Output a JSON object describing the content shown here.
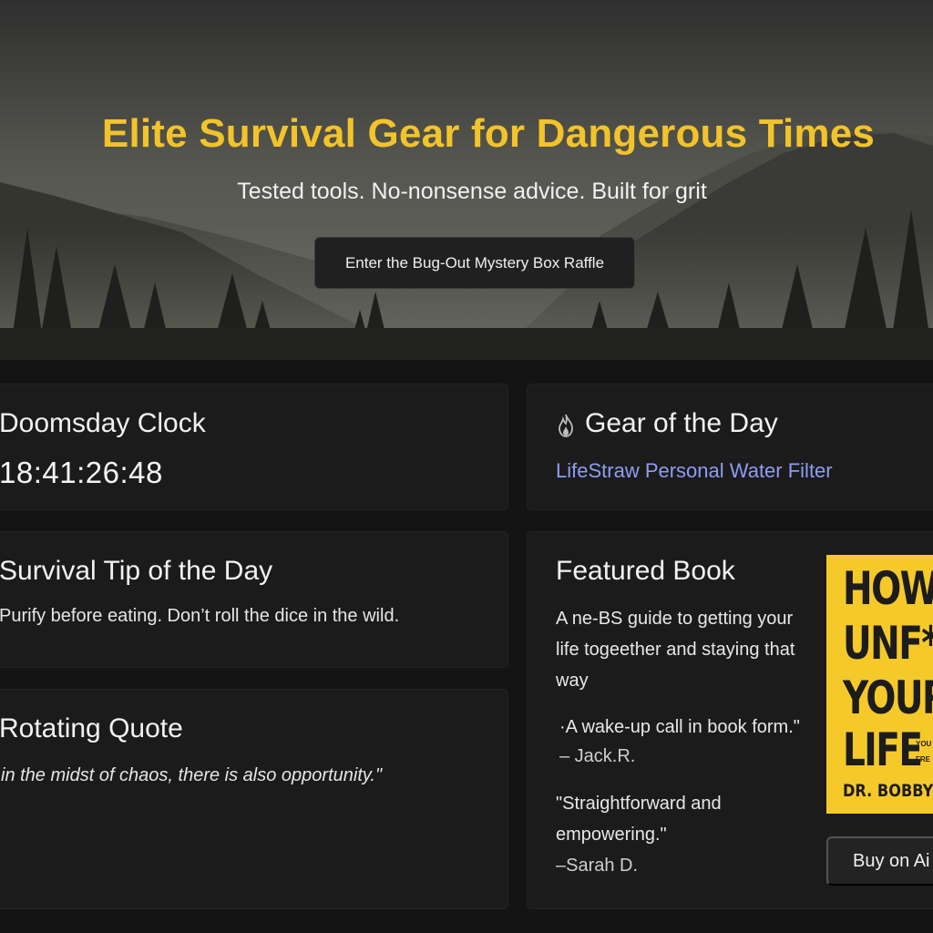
{
  "hero": {
    "title": "Elite Survival Gear for Dangerous Times",
    "subtitle": "Tested tools. No-nonsense advice. Built for grit",
    "cta_label": "Enter the Bug-Out Mystery Box Raffle"
  },
  "doomsday": {
    "title": "Doomsday Clock",
    "value": "18:41:26:48"
  },
  "gear": {
    "icon": "flame-icon",
    "title": "Gear of the Day",
    "item": "LifeStraw Personal Water Filter"
  },
  "tip": {
    "title": "Survival Tip of the Day",
    "text": "Purify before eating. Don’t roll the dice in the wild."
  },
  "quote": {
    "title": "Rotating Quote",
    "text": "in the midst of chaos, there is also opportunity.\""
  },
  "book": {
    "title": "Featured Book",
    "description": "A ne-BS guide to getting your life togeether and staying that way",
    "reviews": [
      {
        "quote": "·A wake-up call in book form.\"",
        "author": "– Jack.R."
      },
      {
        "quote": "\"Straightforward and empowering.\"",
        "author": "–Sarah D."
      }
    ],
    "cover": {
      "lines": [
        "HOW T",
        "UNF*",
        "YOUR",
        "LIFE"
      ],
      "small_lines": [
        "YOU",
        "FRE"
      ],
      "author": "DR. BOBBY I"
    },
    "buy_label": "Buy on Ai"
  },
  "colors": {
    "accent": "#f3c32a",
    "link": "#8f9cf3",
    "background": "#141414",
    "card": "#1b1b1b"
  }
}
